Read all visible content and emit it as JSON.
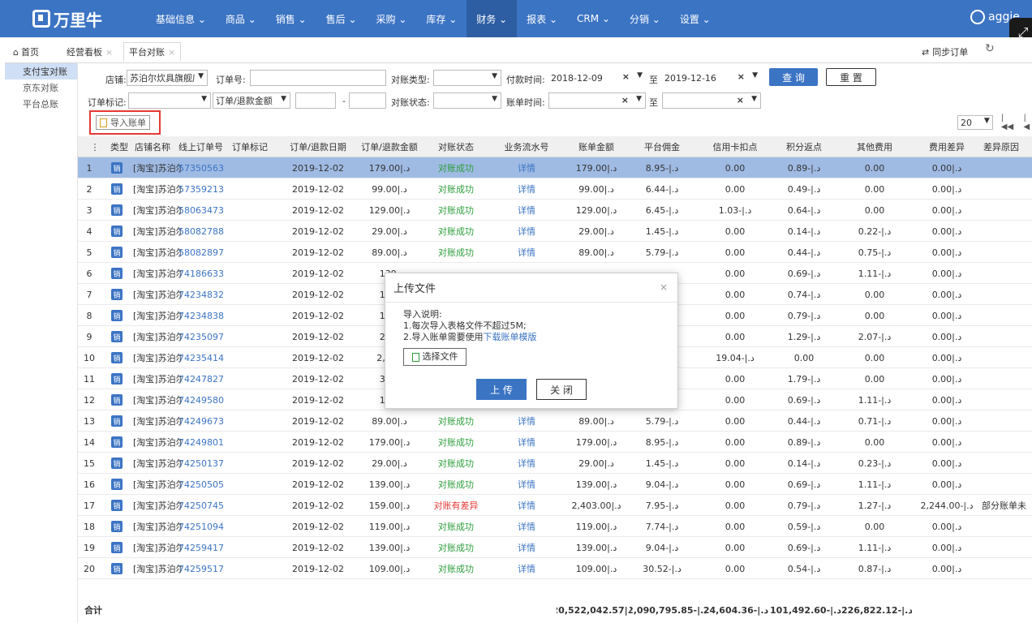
{
  "app": {
    "logo": "万里牛",
    "user": "aggie"
  },
  "menu": [
    "基础信息 ⌄",
    "商品 ⌄",
    "销售 ⌄",
    "售后 ⌄",
    "采购 ⌄",
    "库存 ⌄",
    "财务 ⌄",
    "报表 ⌄",
    "CRM ⌄",
    "分销 ⌄",
    "设置 ⌄"
  ],
  "tabs": {
    "home": "首页",
    "t1": "经营看板",
    "t2": "平台对账"
  },
  "toolbar": {
    "sync": "同步订单"
  },
  "sidebar": [
    "支付宝对账",
    "京东对账",
    "平台总账"
  ],
  "filters": {
    "shop_label": "店铺:",
    "shop_value": "苏泊尔炊具旗舰店",
    "order_no_label": "订单号:",
    "recon_type_label": "对账类型:",
    "pay_time_label": "付款时间:",
    "pay_from": "2018-12-09",
    "to": "至",
    "pay_to": "2019-12-16",
    "query": "查 询",
    "reset": "重 置",
    "order_mark_label": "订单标记:",
    "amount_label": "订单/退款金额",
    "dash": "-",
    "recon_status_label": "对账状态:",
    "bill_time_label": "账单时间:",
    "to2": "至"
  },
  "import_btn": "导入账单",
  "pager": {
    "size": "20"
  },
  "grid": {
    "headers": [
      "类型",
      "店铺名称",
      "线上订单号",
      "订单标记",
      "订单/退款日期",
      "订单/退款金额",
      "对账状态",
      "业务流水号",
      "账单金额",
      "平台佣金",
      "信用卡扣点",
      "积分返点",
      "其他费用",
      "费用差异",
      "差异原因"
    ],
    "rows": [
      {
        "n": "1",
        "shop": "[淘宝]苏泊尔",
        "order": "57350563",
        "date": "2019-12-02",
        "amt": "179.00|.د",
        "st": "对账成功",
        "flow": "详情",
        "bill": "179.00|.د",
        "comm": "8.95-|.د",
        "cc": "0.00",
        "pts": "0.89-|.د",
        "oth": "0.00",
        "diff": "0.00|.د",
        "reason": ""
      },
      {
        "n": "2",
        "shop": "[淘宝]苏泊尔",
        "order": "57359213",
        "date": "2019-12-02",
        "amt": "99.00|.د",
        "st": "对账成功",
        "flow": "详情",
        "bill": "99.00|.د",
        "comm": "6.44-|.د",
        "cc": "0.00",
        "pts": "0.49-|.د",
        "oth": "0.00",
        "diff": "0.00|.د",
        "reason": ""
      },
      {
        "n": "3",
        "shop": "[淘宝]苏泊尔",
        "order": "58063473",
        "date": "2019-12-02",
        "amt": "129.00|.د",
        "st": "对账成功",
        "flow": "详情",
        "bill": "129.00|.د",
        "comm": "6.45-|.د",
        "cc": "1.03-|.د",
        "pts": "0.64-|.د",
        "oth": "0.00",
        "diff": "0.00|.د",
        "reason": ""
      },
      {
        "n": "4",
        "shop": "[淘宝]苏泊尔",
        "order": "58082788",
        "date": "2019-12-02",
        "amt": "29.00|.د",
        "st": "对账成功",
        "flow": "详情",
        "bill": "29.00|.د",
        "comm": "1.45-|.د",
        "cc": "0.00",
        "pts": "0.14-|.د",
        "oth": "0.22-|.د",
        "diff": "0.00|.د",
        "reason": ""
      },
      {
        "n": "5",
        "shop": "[淘宝]苏泊尔",
        "order": "58082897",
        "date": "2019-12-02",
        "amt": "89.00|.د",
        "st": "对账成功",
        "flow": "详情",
        "bill": "89.00|.د",
        "comm": "5.79-|.د",
        "cc": "0.00",
        "pts": "0.44-|.د",
        "oth": "0.75-|.د",
        "diff": "0.00|.د",
        "reason": ""
      },
      {
        "n": "6",
        "shop": "[淘宝]苏泊尔",
        "order": "74186633",
        "date": "2019-12-02",
        "amt": "139.",
        "st": "",
        "flow": "",
        "bill": "",
        "comm": "",
        "cc": "0.00",
        "pts": "0.69-|.د",
        "oth": "1.11-|.د",
        "diff": "0.00|.د",
        "reason": ""
      },
      {
        "n": "7",
        "shop": "[淘宝]苏泊尔",
        "order": "74234832",
        "date": "2019-12-02",
        "amt": "149.",
        "st": "",
        "flow": "",
        "bill": "",
        "comm": "",
        "cc": "0.00",
        "pts": "0.74-|.د",
        "oth": "0.00",
        "diff": "0.00|.د",
        "reason": ""
      },
      {
        "n": "8",
        "shop": "[淘宝]苏泊尔",
        "order": "74234838",
        "date": "2019-12-02",
        "amt": "159.",
        "st": "",
        "flow": "",
        "bill": "",
        "comm": "",
        "cc": "0.00",
        "pts": "0.79-|.د",
        "oth": "0.00",
        "diff": "0.00|.د",
        "reason": ""
      },
      {
        "n": "9",
        "shop": "[淘宝]苏泊尔",
        "order": "74235097",
        "date": "2019-12-02",
        "amt": "259.",
        "st": "",
        "flow": "",
        "bill": "",
        "comm": "",
        "cc": "0.00",
        "pts": "1.29-|.د",
        "oth": "2.07-|.د",
        "diff": "0.00|.د",
        "reason": ""
      },
      {
        "n": "10",
        "shop": "[淘宝]苏泊尔",
        "order": "74235414",
        "date": "2019-12-02",
        "amt": "2,380",
        "st": "",
        "flow": "",
        "bill": "",
        "comm": "",
        "cc": "19.04-|.د",
        "pts": "0.00",
        "oth": "0.00",
        "diff": "0.00|.د",
        "reason": ""
      },
      {
        "n": "11",
        "shop": "[淘宝]苏泊尔",
        "order": "74247827",
        "date": "2019-12-02",
        "amt": "359.",
        "st": "",
        "flow": "",
        "bill": "",
        "comm": "",
        "cc": "0.00",
        "pts": "1.79-|.د",
        "oth": "0.00",
        "diff": "0.00|.د",
        "reason": ""
      },
      {
        "n": "12",
        "shop": "[淘宝]苏泊尔",
        "order": "74249580",
        "date": "2019-12-02",
        "amt": "139.",
        "st": "",
        "flow": "",
        "bill": "",
        "comm": "",
        "cc": "0.00",
        "pts": "0.69-|.د",
        "oth": "1.11-|.د",
        "diff": "0.00|.د",
        "reason": ""
      },
      {
        "n": "13",
        "shop": "[淘宝]苏泊尔",
        "order": "74249673",
        "date": "2019-12-02",
        "amt": "89.00|.د",
        "st": "对账成功",
        "flow": "详情",
        "bill": "89.00|.د",
        "comm": "5.79-|.د",
        "cc": "0.00",
        "pts": "0.44-|.د",
        "oth": "0.71-|.د",
        "diff": "0.00|.د",
        "reason": ""
      },
      {
        "n": "14",
        "shop": "[淘宝]苏泊尔",
        "order": "74249801",
        "date": "2019-12-02",
        "amt": "179.00|.د",
        "st": "对账成功",
        "flow": "详情",
        "bill": "179.00|.د",
        "comm": "8.95-|.د",
        "cc": "0.00",
        "pts": "0.89-|.د",
        "oth": "0.00",
        "diff": "0.00|.د",
        "reason": ""
      },
      {
        "n": "15",
        "shop": "[淘宝]苏泊尔",
        "order": "74250137",
        "date": "2019-12-02",
        "amt": "29.00|.د",
        "st": "对账成功",
        "flow": "详情",
        "bill": "29.00|.د",
        "comm": "1.45-|.د",
        "cc": "0.00",
        "pts": "0.14-|.د",
        "oth": "0.23-|.د",
        "diff": "0.00|.د",
        "reason": ""
      },
      {
        "n": "16",
        "shop": "[淘宝]苏泊尔",
        "order": "74250505",
        "date": "2019-12-02",
        "amt": "139.00|.د",
        "st": "对账成功",
        "flow": "详情",
        "bill": "139.00|.د",
        "comm": "9.04-|.د",
        "cc": "0.00",
        "pts": "0.69-|.د",
        "oth": "1.11-|.د",
        "diff": "0.00|.د",
        "reason": ""
      },
      {
        "n": "17",
        "shop": "[淘宝]苏泊尔",
        "order": "74250745",
        "date": "2019-12-02",
        "amt": "159.00|.د",
        "st": "对账有差异",
        "flow": "详情",
        "bill": "2,403.00|.د",
        "comm": "7.95-|.د",
        "cc": "0.00",
        "pts": "0.79-|.د",
        "oth": "1.27-|.د",
        "diff": "2,244.00-|.د",
        "reason": "部分账单未"
      },
      {
        "n": "18",
        "shop": "[淘宝]苏泊尔",
        "order": "74251094",
        "date": "2019-12-02",
        "amt": "119.00|.د",
        "st": "对账成功",
        "flow": "详情",
        "bill": "119.00|.د",
        "comm": "7.74-|.د",
        "cc": "0.00",
        "pts": "0.59-|.د",
        "oth": "0.00",
        "diff": "0.00|.د",
        "reason": ""
      },
      {
        "n": "19",
        "shop": "[淘宝]苏泊尔",
        "order": "74259417",
        "date": "2019-12-02",
        "amt": "139.00|.د",
        "st": "对账成功",
        "flow": "详情",
        "bill": "139.00|.د",
        "comm": "9.04-|.د",
        "cc": "0.00",
        "pts": "0.69-|.د",
        "oth": "1.11-|.د",
        "diff": "0.00|.د",
        "reason": ""
      },
      {
        "n": "20",
        "shop": "[淘宝]苏泊尔",
        "order": "74259517",
        "date": "2019-12-02",
        "amt": "109.00|.د",
        "st": "对账成功",
        "flow": "详情",
        "bill": "109.00|.د",
        "comm": "30.52-|.د",
        "cc": "0.00",
        "pts": "0.54-|.د",
        "oth": "0.87-|.د",
        "diff": "0.00|.د",
        "reason": ""
      }
    ],
    "footer": {
      "label": "合计",
      "bill": "20,522,042.57|.د",
      "comm": "2,090,795.85-|.د",
      "cc": "24,604.36-|.د",
      "pts": "101,492.60-|.د",
      "oth": "226,822.12-|.د"
    }
  },
  "modal": {
    "title": "上传文件",
    "desc_title": "导入说明:",
    "line1": "1.每次导入表格文件不超过5M;",
    "line2": "2.导入账单需要使用",
    "link": "下载账单模版",
    "choose": "选择文件",
    "upload": "上 传",
    "close": "关 闭"
  },
  "colors": {
    "brand": "#3c74c4",
    "success": "#2e9e3c",
    "error": "#e53935",
    "selected_row": "#9fbbe4"
  }
}
